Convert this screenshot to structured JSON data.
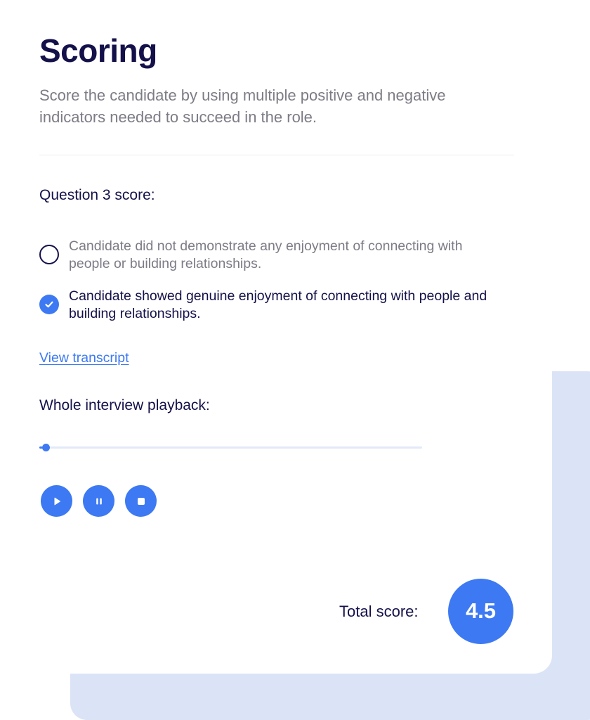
{
  "scoring": {
    "title": "Scoring",
    "subtitle": "Score the candidate by using multiple positive and negative indicators needed to succeed in the role."
  },
  "question": {
    "label": "Question 3 score:",
    "options": [
      {
        "label": "Candidate did not demonstrate any enjoyment of connecting with people or building relationships.",
        "selected": false
      },
      {
        "label": "Candidate showed genuine enjoyment of connecting with people and building relationships.",
        "selected": true
      }
    ]
  },
  "transcript": {
    "link_label": "View transcript"
  },
  "playback": {
    "label": "Whole interview playback:",
    "progress": 0.01,
    "controls": [
      {
        "icon": "play-icon"
      },
      {
        "icon": "pause-icon"
      },
      {
        "icon": "stop-icon"
      }
    ]
  },
  "total": {
    "label": "Total score:",
    "value": "4.5"
  },
  "colors": {
    "accent": "#3d79f2",
    "heading": "#14114a",
    "muted_text": "#7c7c86",
    "backdrop": "#dbe3f7",
    "track": "#e2e9f9"
  }
}
